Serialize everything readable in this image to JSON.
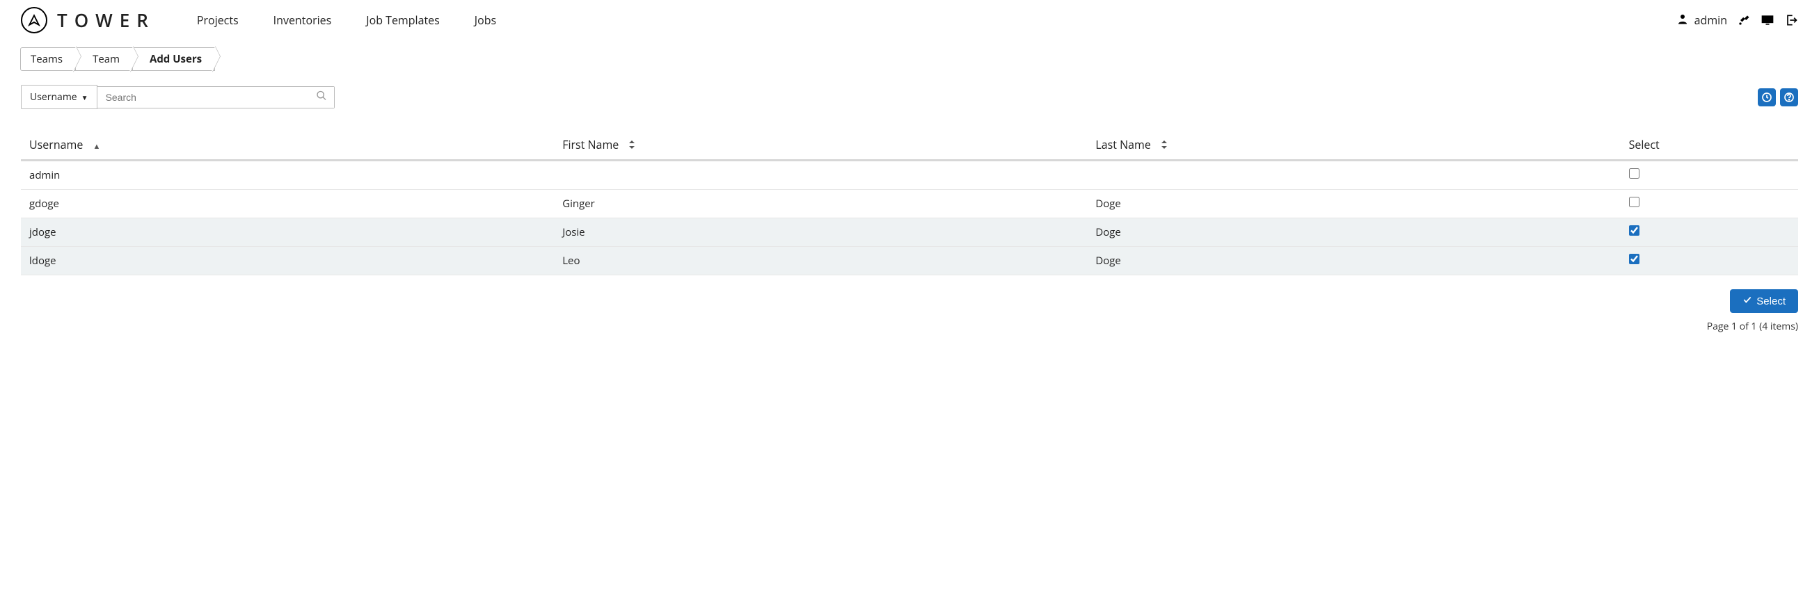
{
  "brand": {
    "name": "TOWER"
  },
  "nav": {
    "projects": "Projects",
    "inventories": "Inventories",
    "job_templates": "Job Templates",
    "jobs": "Jobs"
  },
  "user": {
    "name": "admin"
  },
  "breadcrumb": {
    "teams": "Teams",
    "team": "Team",
    "add_users": "Add Users"
  },
  "filter": {
    "field_label": "Username",
    "search_placeholder": "Search"
  },
  "table": {
    "headers": {
      "username": "Username",
      "first_name": "First Name",
      "last_name": "Last Name",
      "select": "Select"
    },
    "rows": [
      {
        "username": "admin",
        "first_name": "",
        "last_name": "",
        "selected": false
      },
      {
        "username": "gdoge",
        "first_name": "Ginger",
        "last_name": "Doge",
        "selected": false
      },
      {
        "username": "jdoge",
        "first_name": "Josie",
        "last_name": "Doge",
        "selected": true
      },
      {
        "username": "ldoge",
        "first_name": "Leo",
        "last_name": "Doge",
        "selected": true
      }
    ]
  },
  "buttons": {
    "select": "Select"
  },
  "pagination": {
    "status": "Page 1 of 1 (4 items)"
  }
}
